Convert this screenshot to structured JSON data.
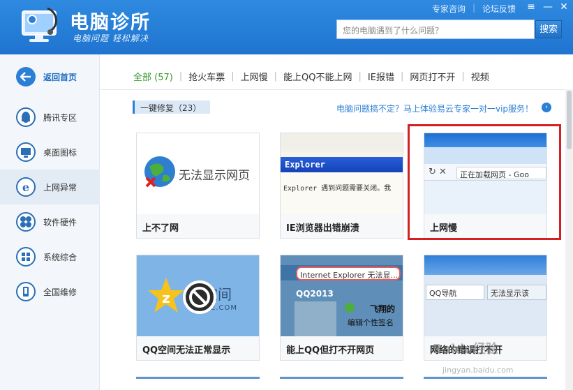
{
  "header": {
    "title": "电脑诊所",
    "slogan": "电脑问题 轻松解决",
    "links": [
      "专家咨询",
      "论坛反馈"
    ],
    "search_placeholder": "您的电脑遇到了什么问题？",
    "search_button": "搜索",
    "minimize": "—",
    "close": "✕"
  },
  "sidebar": {
    "items": [
      {
        "label": "返回首页",
        "icon": "back-arrow-icon"
      },
      {
        "label": "腾讯专区",
        "icon": "qq-penguin-icon"
      },
      {
        "label": "桌面图标",
        "icon": "monitor-icon"
      },
      {
        "label": "上网异常",
        "icon": "ie-icon"
      },
      {
        "label": "软件硬件",
        "icon": "clover-icon"
      },
      {
        "label": "系统综合",
        "icon": "windows-icon"
      },
      {
        "label": "全国维修",
        "icon": "phone-icon"
      }
    ],
    "active_index": 3
  },
  "tabs": [
    "全部 (57)",
    "抢火车票",
    "上网慢",
    "能上QQ不能上网",
    "IE报错",
    "网页打不开",
    "视频"
  ],
  "fix_section": {
    "label": "一键修复（23）",
    "promo": "电脑问题搞不定？马上体验易云专家一对一vip服务！"
  },
  "cards": [
    {
      "caption": "上不了网",
      "thumb_text": "无法显示网页"
    },
    {
      "caption": "IE浏览器出错崩溃",
      "thumb_title": "Explorer",
      "thumb_text": "Explorer 遇到问题需要关闭。我"
    },
    {
      "caption": "上网慢",
      "thumb_text": "正在加载网页 - Goo"
    },
    {
      "caption": "QQ空间无法正常显示",
      "thumb_text": "空间",
      "thumb_sub": "E.COM"
    },
    {
      "caption": "能上QQ但打不开网页",
      "thumb_title": "Internet Explorer 无法显...",
      "thumb_qq": "QQ2013",
      "thumb_name": "飞翔的",
      "thumb_sign": "编辑个性签名"
    },
    {
      "caption": "网络的错误打不开",
      "thumb_tab1": "QQ导航",
      "thumb_tab2": "无法显示该"
    }
  ],
  "watermark": {
    "line1": "Baidu经验",
    "line2": "jingyan.baidu.com"
  },
  "colors": {
    "header": "#1f74cf",
    "accent": "#2b7fd6",
    "active_tab": "#3a9a2f",
    "highlight": "#d41f24"
  }
}
